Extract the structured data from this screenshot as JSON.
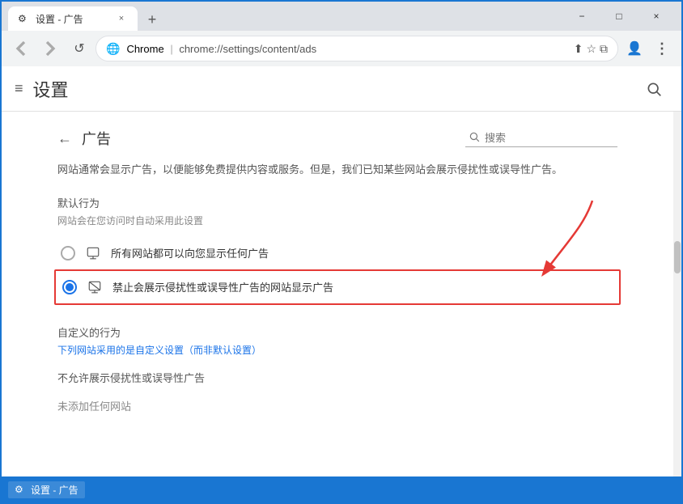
{
  "window": {
    "title": "设置 - 广告",
    "tab_favicon": "⚙",
    "tab_label": "设置 - 广告",
    "new_tab_symbol": "+",
    "close_symbol": "×",
    "minimize_symbol": "−",
    "maximize_symbol": "□"
  },
  "nav": {
    "back_disabled": true,
    "forward_disabled": true,
    "reload_symbol": "↺",
    "url_site": "Chrome",
    "url_separator": "|",
    "url_path": "chrome://settings/content/ads",
    "share_symbol": "⬆",
    "star_symbol": "☆",
    "split_symbol": "⧉",
    "account_symbol": "👤",
    "menu_symbol": "⋮"
  },
  "toolbar": {
    "hamburger": "≡",
    "title": "设置",
    "search_symbol": "🔍"
  },
  "content": {
    "back_symbol": "←",
    "page_title": "广告",
    "search_placeholder": "搜索",
    "description": "网站通常会显示广告，以便能够免费提供内容或服务。但是，我们已知某些网站会展示侵扰性或误导性广告。",
    "default_behavior_header": "默认行为",
    "default_behavior_subtext": "网站会在您访问时自动采用此设置",
    "option1": {
      "label": "所有网站都可以向您显示任何广告",
      "selected": false
    },
    "option2": {
      "label": "禁止会展示侵扰性或误导性广告的网站显示广告",
      "selected": true
    },
    "custom_section_header": "自定义的行为",
    "custom_section_subtext": "下列网站采用的是自定义设置（而非默认设置）",
    "no_intrusive_header": "不允许展示侵扰性或误导性广告",
    "no_sites_added": "未添加任何网站"
  },
  "taskbar": {
    "app_label": "设置 - 广告",
    "favicon": "⚙"
  }
}
